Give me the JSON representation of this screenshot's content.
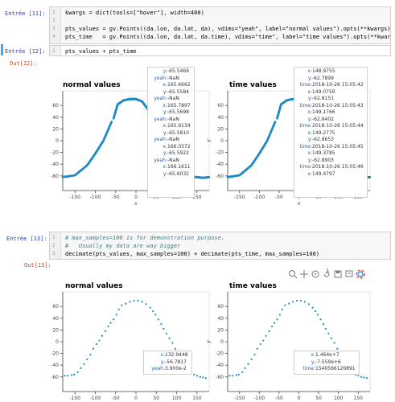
{
  "cells": {
    "c11": {
      "prompt": "Entrée [11]:",
      "lines": [
        "kwargs = dict(tools=[\"hover\"], width=400)",
        "",
        "pts_values = gv.Points((da.lon, da.lat, da), vdims=\"yeah\", label=\"normal values\").opts(**kwargs)",
        "pts_time   = gv.Points((da.lon, da.lat, da.time), vdims=\"time\", label=\"time values\").opts(**kwargs)"
      ]
    },
    "c12": {
      "prompt": "Entrée [12]:",
      "lines": [
        "pts_values + pts_time"
      ],
      "out": "Out[12]:"
    },
    "c13": {
      "prompt": "Entrée [13]:",
      "lines": [
        "# max_samples=100 is for demonstration purpose.",
        "#   Usually my data are way bigger",
        "decimate(pts_values, max_samples=100) + decimate(pts_time, max_samples=100)"
      ],
      "out": "Out[13]:"
    }
  },
  "plots": {
    "p1_title": "normal values",
    "p2_title": "time values",
    "p3_title": "normal values",
    "p4_title": "time values",
    "xlabel": "x",
    "ylabel": "y"
  },
  "tooltips": {
    "t1": [
      [
        "y:",
        "-65.5469"
      ],
      [
        "yeah:",
        "-NaN"
      ],
      [
        "x:",
        "165.6662"
      ],
      [
        "y:",
        "-65.5584"
      ],
      [
        "yeah:",
        "-NaN"
      ],
      [
        "x:",
        "165.7897"
      ],
      [
        "y:",
        "-65.5698"
      ],
      [
        "yeah:",
        "-NaN"
      ],
      [
        "x:",
        "165.9134"
      ],
      [
        "y:",
        "-65.5810"
      ],
      [
        "yeah:",
        "-NaN"
      ],
      [
        "x:",
        "166.0372"
      ],
      [
        "y:",
        "-65.5922"
      ],
      [
        "yeah:",
        "-NaN"
      ],
      [
        "x:",
        "166.1611"
      ],
      [
        "y:",
        "-65.6032"
      ]
    ],
    "t2": [
      [
        "x:",
        "148.9755"
      ],
      [
        "y:",
        "-62.7899"
      ],
      [
        "time:",
        "2018-10-26 15:05:42"
      ],
      [
        "x:",
        "149.0759"
      ],
      [
        "y:",
        "-62.8151"
      ],
      [
        "time:",
        "2018-10-26 15:05:43"
      ],
      [
        "x:",
        "149.1766"
      ],
      [
        "y:",
        "-62.8402"
      ],
      [
        "time:",
        "2018-10-26 15:05:44"
      ],
      [
        "x:",
        "149.2775"
      ],
      [
        "y:",
        "-62.8653"
      ],
      [
        "time:",
        "2018-10-26 15:05:45"
      ],
      [
        "x:",
        "149.3785"
      ],
      [
        "y:",
        "-62.8903"
      ],
      [
        "time:",
        "2018-10-26 15:05:46"
      ],
      [
        "x:",
        "149.4797"
      ]
    ],
    "t3": [
      [
        "x:",
        "132.9448"
      ],
      [
        "y:",
        "-56.7817"
      ],
      [
        "yeah:",
        "3.900e-2"
      ]
    ],
    "t4": [
      [
        "x:",
        "1.464e+7"
      ],
      [
        "y:",
        "-7.559e+6"
      ],
      [
        "time:",
        "1540566126891"
      ]
    ]
  },
  "chart_data": [
    {
      "type": "scatter",
      "title": "normal values",
      "xlabel": "x",
      "ylabel": "",
      "xlim": [
        -180,
        180
      ],
      "ylim": [
        -85,
        85
      ],
      "xticks": [
        -150,
        -100,
        -50,
        0,
        50,
        100,
        150
      ],
      "yticks": [
        60,
        40,
        20,
        0,
        -20,
        -40,
        -60
      ],
      "style": "dense",
      "curve_x": [
        -180,
        -150,
        -120,
        -100,
        -80,
        -60,
        -55,
        -45,
        -30,
        -15,
        0,
        15,
        30,
        45,
        60,
        80,
        100,
        120,
        140,
        150,
        160,
        170,
        180
      ],
      "curve_y": [
        -62,
        -59,
        -42,
        -22,
        0,
        32,
        38,
        62,
        69,
        71,
        71,
        67,
        53,
        30,
        0,
        -33,
        -52,
        -60,
        -62,
        -62,
        -63,
        -63,
        -62
      ]
    },
    {
      "type": "scatter",
      "title": "time values",
      "xlabel": "x",
      "ylabel": "y",
      "xlim": [
        -180,
        180
      ],
      "ylim": [
        -85,
        85
      ],
      "xticks": [
        -150,
        -100,
        -50,
        0,
        50,
        100,
        150
      ],
      "yticks": [
        60,
        40,
        20,
        0,
        -20,
        -40,
        -60
      ],
      "style": "dense",
      "curve_x": [
        -180,
        -150,
        -120,
        -100,
        -80,
        -60,
        -55,
        -45,
        -30,
        -15,
        0,
        15,
        30,
        45,
        60,
        80,
        100,
        120,
        140,
        150,
        160,
        170,
        180
      ],
      "curve_y": [
        -62,
        -59,
        -42,
        -22,
        0,
        32,
        38,
        62,
        69,
        71,
        71,
        67,
        53,
        30,
        0,
        -33,
        -52,
        -60,
        -62,
        -62,
        -63,
        -63,
        -62
      ]
    },
    {
      "type": "scatter",
      "title": "normal values",
      "xlabel": "x",
      "ylabel": "",
      "xlim": [
        -180,
        180
      ],
      "ylim": [
        -85,
        85
      ],
      "xticks": [
        -150,
        -100,
        -50,
        0,
        50,
        100,
        150
      ],
      "yticks": [
        60,
        40,
        20,
        0,
        -20,
        -40,
        -60
      ],
      "style": "sparse",
      "x": [
        -175,
        -168,
        -158,
        -152,
        -143,
        -136,
        -128,
        -120,
        -112,
        -105,
        -97,
        -90,
        -83,
        -75,
        -68,
        -62,
        -55,
        -48,
        -42,
        -35,
        -25,
        -15,
        -5,
        5,
        15,
        25,
        35,
        42,
        48,
        55,
        62,
        68,
        75,
        82,
        90,
        97,
        105,
        112,
        120,
        128,
        136,
        143,
        150,
        158,
        165,
        172
      ],
      "y": [
        -58,
        -58,
        -57,
        -56,
        -52,
        -45,
        -38,
        -30,
        -22,
        -12,
        -4,
        2,
        10,
        18,
        26,
        32,
        38,
        46,
        55,
        62,
        65,
        68,
        70,
        70,
        68,
        64,
        58,
        52,
        46,
        38,
        30,
        22,
        14,
        6,
        -2,
        -12,
        -22,
        -32,
        -40,
        -48,
        -52,
        -56,
        -58,
        -60,
        -61,
        -62
      ]
    },
    {
      "type": "scatter",
      "title": "time values",
      "xlabel": "x",
      "ylabel": "y",
      "xlim": [
        -180,
        180
      ],
      "ylim": [
        -85,
        85
      ],
      "xticks": [
        -150,
        -100,
        -50,
        0,
        50,
        100,
        150
      ],
      "yticks": [
        60,
        40,
        20,
        0,
        -20,
        -40,
        -60
      ],
      "style": "sparse",
      "x": [
        -175,
        -168,
        -158,
        -152,
        -143,
        -136,
        -128,
        -120,
        -112,
        -105,
        -97,
        -90,
        -83,
        -75,
        -68,
        -62,
        -55,
        -48,
        -42,
        -35,
        -25,
        -15,
        -5,
        5,
        15,
        25,
        35,
        42,
        48,
        55,
        62,
        68,
        75,
        82,
        90,
        97,
        105,
        112,
        120,
        128,
        136,
        143,
        150,
        158,
        165,
        172
      ],
      "y": [
        -58,
        -58,
        -57,
        -56,
        -52,
        -45,
        -38,
        -30,
        -22,
        -12,
        -4,
        2,
        10,
        18,
        26,
        32,
        38,
        46,
        55,
        62,
        65,
        68,
        70,
        70,
        68,
        64,
        58,
        52,
        46,
        38,
        30,
        22,
        14,
        6,
        -2,
        -12,
        -22,
        -32,
        -40,
        -48,
        -52,
        -56,
        -58,
        -60,
        -61,
        -62
      ]
    }
  ]
}
